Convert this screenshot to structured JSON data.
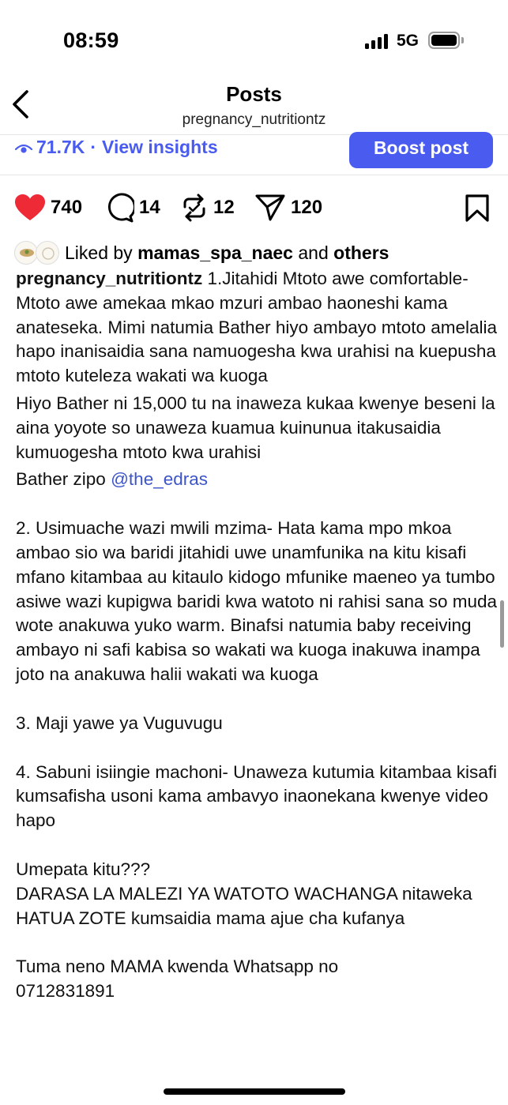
{
  "status_bar": {
    "time": "08:59",
    "network": "5G"
  },
  "header": {
    "title": "Posts",
    "subtitle": "pregnancy_nutritiontz"
  },
  "insights": {
    "views": "71.7K",
    "separator": "·",
    "link_label": "View insights",
    "boost_label": "Boost post"
  },
  "actions": {
    "likes": "740",
    "comments": "14",
    "reposts": "12",
    "shares": "120"
  },
  "liked_by": {
    "prefix": "Liked by",
    "user": "mamas_spa_naec",
    "and": "and",
    "others": "others"
  },
  "caption": {
    "owner": "pregnancy_nutritiontz",
    "p1": "1.Jitahidi Mtoto awe comfortable- Mtoto awe amekaa mkao mzuri ambao haoneshi kama anateseka. Mimi natumia Bather hiyo ambayo mtoto amelalia hapo inanisaidia sana namuogesha kwa urahisi na kuepusha mtoto kuteleza wakati wa kuoga",
    "p2": "Hiyo Bather ni 15,000 tu na inaweza kukaa kwenye beseni la aina yoyote so unaweza kuamua kuinunua itakusaidia kumuogesha mtoto kwa urahisi",
    "p3_prefix": "Bather zipo",
    "p3_mention": "@the_edras",
    "p4": "2. Usimuache wazi mwili mzima- Hata kama mpo mkoa ambao sio wa baridi jitahidi uwe unamfunika na kitu kisafi mfano kitambaa au kitaulo kidogo mfunike maeneo ya tumbo asiwe wazi kupigwa baridi kwa watoto ni rahisi sana so muda wote anakuwa yuko warm. Binafsi natumia baby receiving ambayo ni safi kabisa so wakati wa kuoga inakuwa inampa joto na anakuwa halii wakati wa kuoga",
    "p5": "3. Maji yawe ya Vuguvugu",
    "p6": "4. Sabuni isiingie machoni- Unaweza kutumia kitambaa kisafi kumsafisha  usoni kama ambavyo inaonekana kwenye video hapo",
    "p7_line1": "Umepata kitu???",
    "p7_line2": "DARASA LA MALEZI YA WATOTO WACHANGA nitaweka HATUA ZOTE kumsaidia mama ajue cha kufanya",
    "p8_line1": "Tuma neno MAMA kwenda Whatsapp no",
    "p8_line2": "0712831891"
  },
  "colors": {
    "accent": "#4a5cf0",
    "like": "#ed2a36",
    "mention": "#3d55c9"
  },
  "icons": [
    "back-chevron-icon",
    "eye-icon",
    "heart-icon",
    "comment-icon",
    "repost-icon",
    "share-icon",
    "bookmark-icon"
  ]
}
